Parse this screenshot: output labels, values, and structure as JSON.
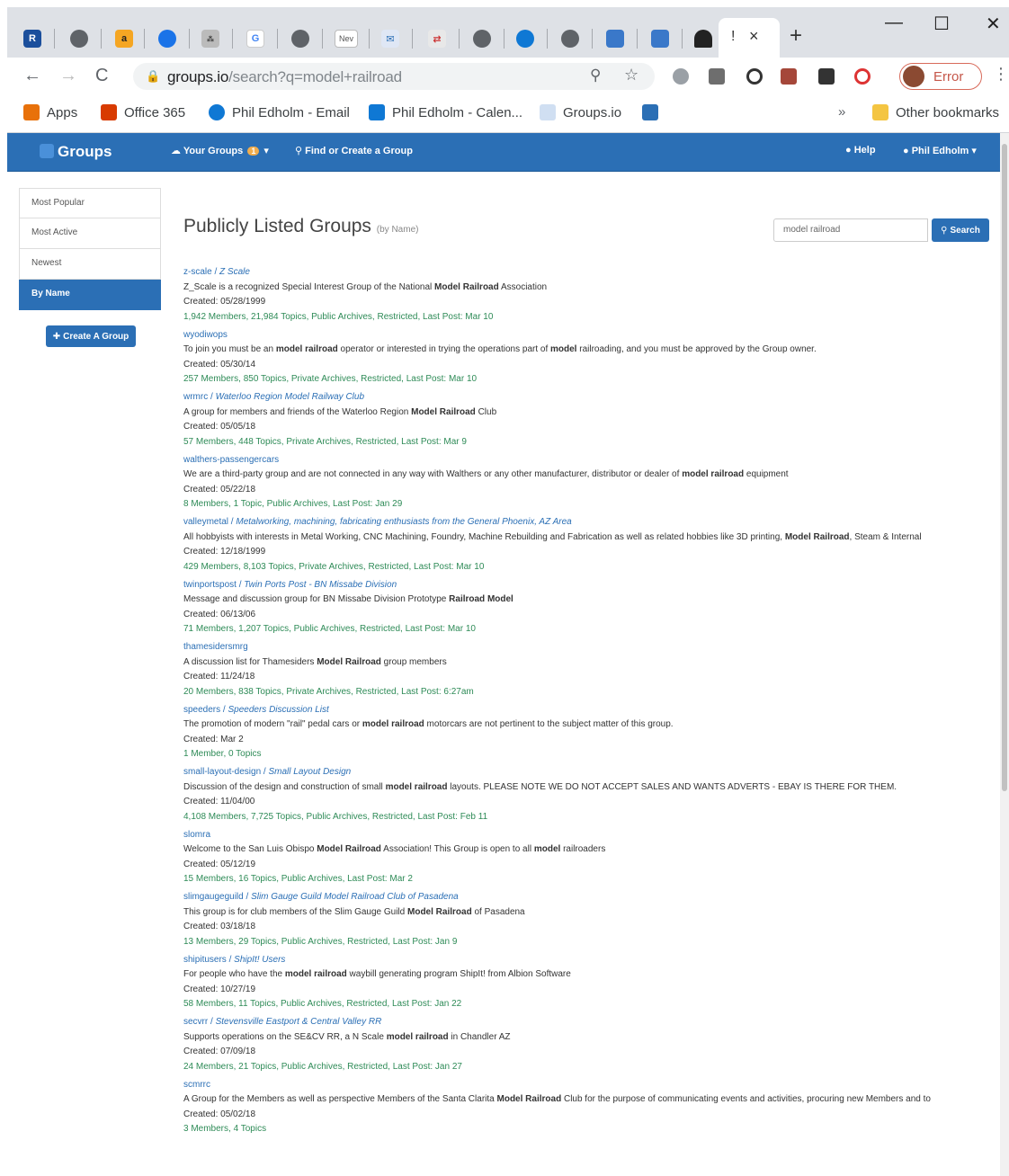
{
  "browser": {
    "active_tab_close": "×",
    "new_tab": "+",
    "window_controls": {
      "minimize": "—",
      "maximize": "☐",
      "close": "✕"
    },
    "url_host": "groups.io",
    "url_path": "/search?q=model+railroad",
    "profile_label": "Error",
    "bookmarks": [
      {
        "label": "Apps",
        "icon": "apps-grid-icon",
        "color": "#e8710a"
      },
      {
        "label": "Office 365",
        "icon": "office-icon",
        "color": "#d83b01"
      },
      {
        "label": "Phil Edholm - Email",
        "icon": "outlook-icon",
        "color": "#0f78d4"
      },
      {
        "label": "Phil Edholm - Calen...",
        "icon": "calendar-icon",
        "color": "#0f78d4"
      },
      {
        "label": "Groups.io",
        "icon": "groups-icon",
        "color": "#2b6fb5"
      }
    ],
    "more_bookmarks": "»",
    "other_bookmarks": "Other bookmarks"
  },
  "navbar": {
    "brand": "Groups",
    "your_groups": "Your Groups",
    "your_groups_count": "1",
    "find_create": "Find or Create a Group",
    "help": "Help",
    "user": "Phil Edholm"
  },
  "sidebar": {
    "items": [
      "Most Popular",
      "Most Active",
      "Newest",
      "By Name"
    ],
    "create_button": "Create A Group"
  },
  "main": {
    "title": "Publicly Listed Groups",
    "title_sub": "(by Name)",
    "search_value": "model railroad",
    "search_button": "Search"
  },
  "groups": [
    {
      "name": "z-scale",
      "subtitle": "Z Scale",
      "desc": "Z_Scale is a recognized Special Interest Group of the National Model Railroad Association",
      "created": "Created: 05/28/1999",
      "stats": "1,942 Members, 21,984 Topics, Public Archives, Restricted, Last Post: Mar 10"
    },
    {
      "name": "wyodiwops",
      "subtitle": "",
      "desc": "To join you must be an model railroad operator or interested in trying the operations part of model railroading, and you must be approved by the Group owner.",
      "created": "Created: 05/30/14",
      "stats": "257 Members, 850 Topics, Private Archives, Restricted, Last Post: Mar 10"
    },
    {
      "name": "wrmrc",
      "subtitle": "Waterloo Region Model Railway Club",
      "desc": "A group for members and friends of the Waterloo Region Model Railroad Club",
      "created": "Created: 05/05/18",
      "stats": "57 Members, 448 Topics, Private Archives, Restricted, Last Post: Mar 9"
    },
    {
      "name": "walthers-passengercars",
      "subtitle": "",
      "desc": "We are a third-party group and are not connected in any way with Walthers or any other manufacturer, distributor or dealer of model railroad equipment",
      "created": "Created: 05/22/18",
      "stats": "8 Members, 1 Topic, Public Archives, Last Post: Jan 29"
    },
    {
      "name": "valleymetal",
      "subtitle": "Metalworking, machining, fabricating enthusiasts from the General Phoenix, AZ Area",
      "desc": "All hobbyists with interests in Metal Working, CNC Machining, Foundry, Machine Rebuilding and Fabrication as well as related hobbies like 3D printing, Model Railroad, Steam & Internal",
      "created": "Created: 12/18/1999",
      "stats": "429 Members, 8,103 Topics, Private Archives, Restricted, Last Post: Mar 10"
    },
    {
      "name": "twinportspost",
      "subtitle": "Twin Ports Post - BN Missabe Division",
      "desc": "Message and discussion group for BN Missabe Division Prototype Railroad Model",
      "created": "Created: 06/13/06",
      "stats": "71 Members, 1,207 Topics, Public Archives, Restricted, Last Post: Mar 10"
    },
    {
      "name": "thamesidersmrg",
      "subtitle": "",
      "desc": "A discussion list for Thamesiders Model Railroad group members",
      "created": "Created: 11/24/18",
      "stats": "20 Members, 838 Topics, Private Archives, Restricted, Last Post: 6:27am"
    },
    {
      "name": "speeders",
      "subtitle": "Speeders Discussion List",
      "desc": "The promotion of modern \"rail\" pedal cars or model railroad motorcars are not pertinent to the subject matter of this group.",
      "created": "Created: Mar 2",
      "stats": "1 Member, 0 Topics"
    },
    {
      "name": "small-layout-design",
      "subtitle": "Small Layout Design",
      "desc": "Discussion of the design and construction of small model railroad layouts. PLEASE NOTE WE DO NOT ACCEPT SALES AND WANTS ADVERTS - EBAY IS THERE FOR THEM.",
      "created": "Created: 11/04/00",
      "stats": "4,108 Members, 7,725 Topics, Public Archives, Restricted, Last Post: Feb 11"
    },
    {
      "name": "slomra",
      "subtitle": "",
      "desc": "Welcome to the San Luis Obispo Model Railroad Association! This Group is open to all model railroaders",
      "created": "Created: 05/12/19",
      "stats": "15 Members, 16 Topics, Public Archives, Last Post: Mar 2"
    },
    {
      "name": "slimgaugeguild",
      "subtitle": "Slim Gauge Guild Model Railroad Club of Pasadena",
      "desc": "This group is for club members of the Slim Gauge Guild Model Railroad of Pasadena",
      "created": "Created: 03/18/18",
      "stats": "13 Members, 29 Topics, Public Archives, Restricted, Last Post: Jan 9"
    },
    {
      "name": "shipitusers",
      "subtitle": "ShipIt! Users",
      "desc": "For people who have the model railroad waybill generating program ShipIt! from Albion Software",
      "created": "Created: 10/27/19",
      "stats": "58 Members, 11 Topics, Public Archives, Restricted, Last Post: Jan 22"
    },
    {
      "name": "secvrr",
      "subtitle": "Stevensville Eastport & Central Valley RR",
      "desc": "Supports operations on the SE&CV RR, a N Scale model railroad in Chandler AZ",
      "created": "Created: 07/09/18",
      "stats": "24 Members, 21 Topics, Public Archives, Restricted, Last Post: Jan 27"
    },
    {
      "name": "scmrrc",
      "subtitle": "",
      "desc": "A Group for the Members as well as perspective Members of the Santa Clarita Model Railroad Club for the purpose of communicating events and activities, procuring new Members and to",
      "created": "Created: 05/02/18",
      "stats": "3 Members, 4 Topics"
    }
  ]
}
